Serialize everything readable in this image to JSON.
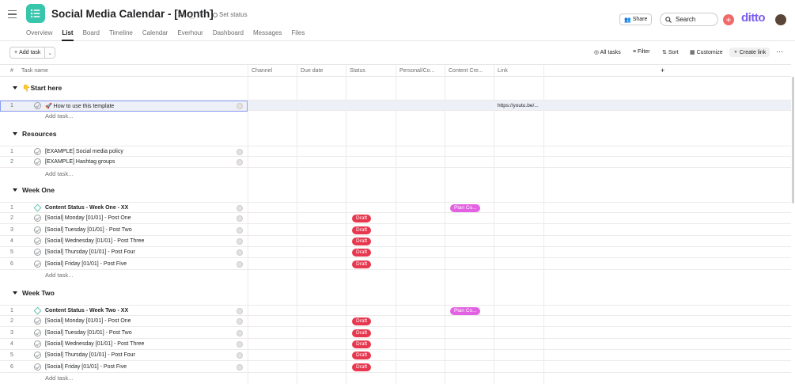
{
  "header": {
    "title": "Social Media Calendar - [Month]",
    "set_status": "Set status",
    "share": "Share",
    "search_placeholder": "Search",
    "brand": "ditto",
    "tabs": [
      {
        "label": "Overview"
      },
      {
        "label": "List",
        "active": true
      },
      {
        "label": "Board"
      },
      {
        "label": "Timeline"
      },
      {
        "label": "Calendar"
      },
      {
        "label": "Everhour"
      },
      {
        "label": "Dashboard"
      },
      {
        "label": "Messages"
      },
      {
        "label": "Files"
      }
    ]
  },
  "toolbar": {
    "add_task": "Add task",
    "all_tasks": "All tasks",
    "filter": "Filter",
    "sort": "Sort",
    "customize": "Customize",
    "create_link": "Create link"
  },
  "columns": {
    "num": "#",
    "task": "Task name",
    "channel": "Channel",
    "due": "Due date",
    "status": "Status",
    "personal": "Personal/Co...",
    "content": "Content Cre...",
    "link": "Link"
  },
  "add_task_row": "Add task...",
  "sections": [
    {
      "name": "👇Start here",
      "rows": [
        {
          "num": "1",
          "name": "🚀 How to use this template",
          "link": "https://youtu.be/..."
        }
      ]
    },
    {
      "name": "Resources",
      "rows": [
        {
          "num": "1",
          "name": "[EXAMPLE] Social media policy"
        },
        {
          "num": "2",
          "name": "[EXAMPLE] Hashtag groups"
        }
      ]
    },
    {
      "name": "Week One",
      "rows": [
        {
          "num": "1",
          "name": "Content Status - Week One - XX",
          "milestone": true,
          "content": "Plan Co..."
        },
        {
          "num": "2",
          "name": "[Social] Monday [01/01] - Post One",
          "status": "Draft"
        },
        {
          "num": "3",
          "name": "[Social] Tuesday [01/01] - Post Two",
          "status": "Draft"
        },
        {
          "num": "4",
          "name": "[Social] Wednesday [01/01] - Post Three",
          "status": "Draft"
        },
        {
          "num": "5",
          "name": "[Social] Thursday [01/01] - Post Four",
          "status": "Draft"
        },
        {
          "num": "6",
          "name": "[Social] Friday [01/01] - Post Five",
          "status": "Draft"
        }
      ]
    },
    {
      "name": "Week Two",
      "rows": [
        {
          "num": "1",
          "name": "Content Status - Week Two - XX",
          "milestone": true,
          "content": "Plan Co..."
        },
        {
          "num": "2",
          "name": "[Social] Monday [01/01] - Post One",
          "status": "Draft"
        },
        {
          "num": "3",
          "name": "[Social] Tuesday [01/01] - Post Two",
          "status": "Draft"
        },
        {
          "num": "4",
          "name": "[Social] Wednesday [01/01] - Post Three",
          "status": "Draft"
        },
        {
          "num": "5",
          "name": "[Social] Thursday [01/01] - Post Four",
          "status": "Draft"
        },
        {
          "num": "6",
          "name": "[Social] Friday [01/01] - Post Five",
          "status": "Draft"
        }
      ]
    }
  ],
  "colors": {
    "accent": "#37c5ab",
    "draft": "#e8384f",
    "plan": "#e362e3",
    "brand": "#7b5cf0"
  }
}
